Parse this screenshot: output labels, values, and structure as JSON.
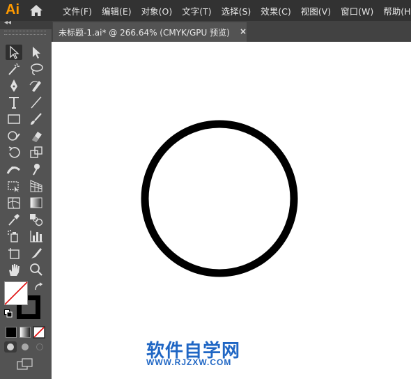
{
  "app": {
    "logo": "Ai",
    "brand_color": "#ff9a00"
  },
  "menubar": {
    "items": [
      "文件(F)",
      "编辑(E)",
      "对象(O)",
      "文字(T)",
      "选择(S)",
      "效果(C)",
      "视图(V)",
      "窗口(W)",
      "帮助(H)"
    ]
  },
  "document_tab": {
    "title": "未标题-1.ai* @ 266.64% (CMYK/GPU 预览)",
    "close_label": "×"
  },
  "toolbox": {
    "collapse_label": "◂◂",
    "tools": [
      "selection-tool",
      "direct-selection-tool",
      "magic-wand-tool",
      "lasso-tool",
      "pen-tool",
      "curvature-tool",
      "type-tool",
      "line-segment-tool",
      "rectangle-tool",
      "paintbrush-tool",
      "shaper-tool",
      "eraser-tool",
      "rotate-tool",
      "scale-tool",
      "width-tool",
      "puppet-warp-tool",
      "free-transform-tool",
      "perspective-grid-tool",
      "mesh-tool",
      "gradient-tool",
      "eyedropper-tool",
      "blend-tool",
      "symbol-sprayer-tool",
      "column-graph-tool",
      "artboard-tool",
      "slice-tool",
      "hand-tool",
      "zoom-tool"
    ],
    "fill_color": "#ffffff",
    "stroke_color": "#000000"
  },
  "canvas": {
    "shape": "circle",
    "stroke_color": "#000000",
    "fill": "none"
  },
  "watermark": {
    "cn": "软件自学网",
    "url": "WWW.RJZXW.COM",
    "color": "#1f66c4"
  }
}
